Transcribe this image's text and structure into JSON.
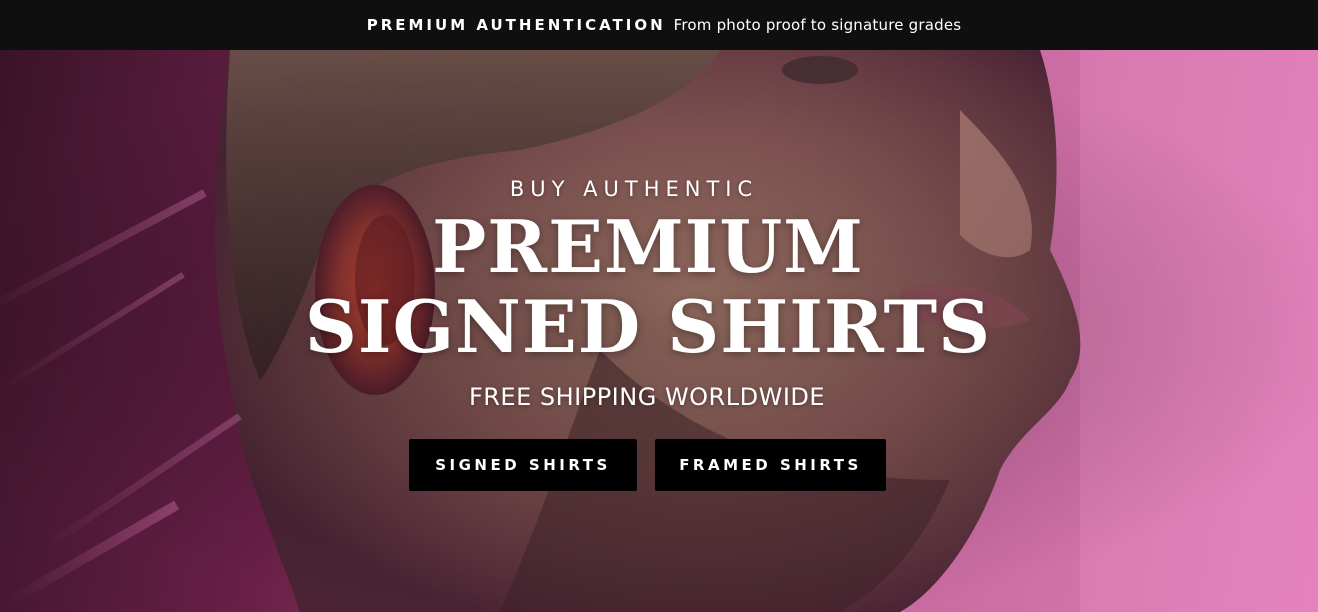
{
  "announcement": {
    "strong": "PREMIUM AUTHENTICATION",
    "text": "From photo proof to signature grades"
  },
  "hero": {
    "eyebrow": "BUY AUTHENTIC",
    "headline": "PREMIUM SIGNED SHIRTS",
    "subhead": "FREE SHIPPING WORLDWIDE",
    "buttons": [
      {
        "label": "SIGNED SHIRTS"
      },
      {
        "label": "FRAMED SHIRTS"
      }
    ]
  },
  "colors": {
    "bar": "#0f0f0f",
    "button": "#000000",
    "text": "#ffffff",
    "accent_pink": "#e07ab8"
  }
}
